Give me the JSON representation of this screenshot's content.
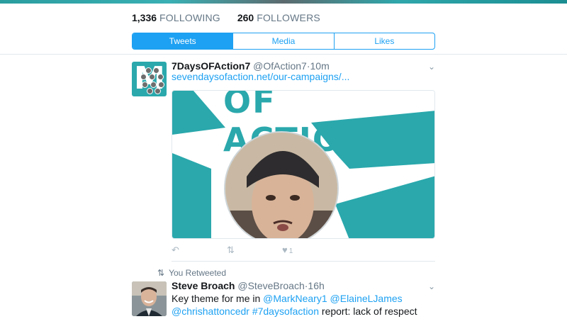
{
  "profile": {
    "following_count": "1,336",
    "following_label": "FOLLOWING",
    "followers_count": "260",
    "followers_label": "FOLLOWERS"
  },
  "tabs": [
    {
      "label": "Tweets",
      "active": true
    },
    {
      "label": "Media",
      "active": false
    },
    {
      "label": "Likes",
      "active": false
    }
  ],
  "tweets": [
    {
      "name": "7DaysOFAction7",
      "handle": "@OfAction7",
      "separator": "·",
      "time": "10m",
      "link": "sevendaysofaction.net/our-campaigns/...",
      "card_text": "OF ACTION",
      "like_count": "1"
    },
    {
      "retweet_note": "You Retweeted",
      "name": "Steve Broach",
      "handle": "@SteveBroach",
      "separator": "·",
      "time": "16h",
      "text_1": "Key theme for me in ",
      "mention_1": "@MarkNeary1",
      "mention_2": "@ElaineLJames",
      "mention_3": "@chrishattoncedr",
      "hashtag": "#7daysofaction",
      "text_2": " report: lack of respect"
    }
  ],
  "colors": {
    "accent": "#1da1f2",
    "brand_teal": "#2aa8ac",
    "muted": "#657786"
  },
  "icons": {
    "reply": "reply-icon",
    "retweet": "retweet-icon",
    "like": "heart-icon",
    "menu": "chevron-down-icon"
  }
}
